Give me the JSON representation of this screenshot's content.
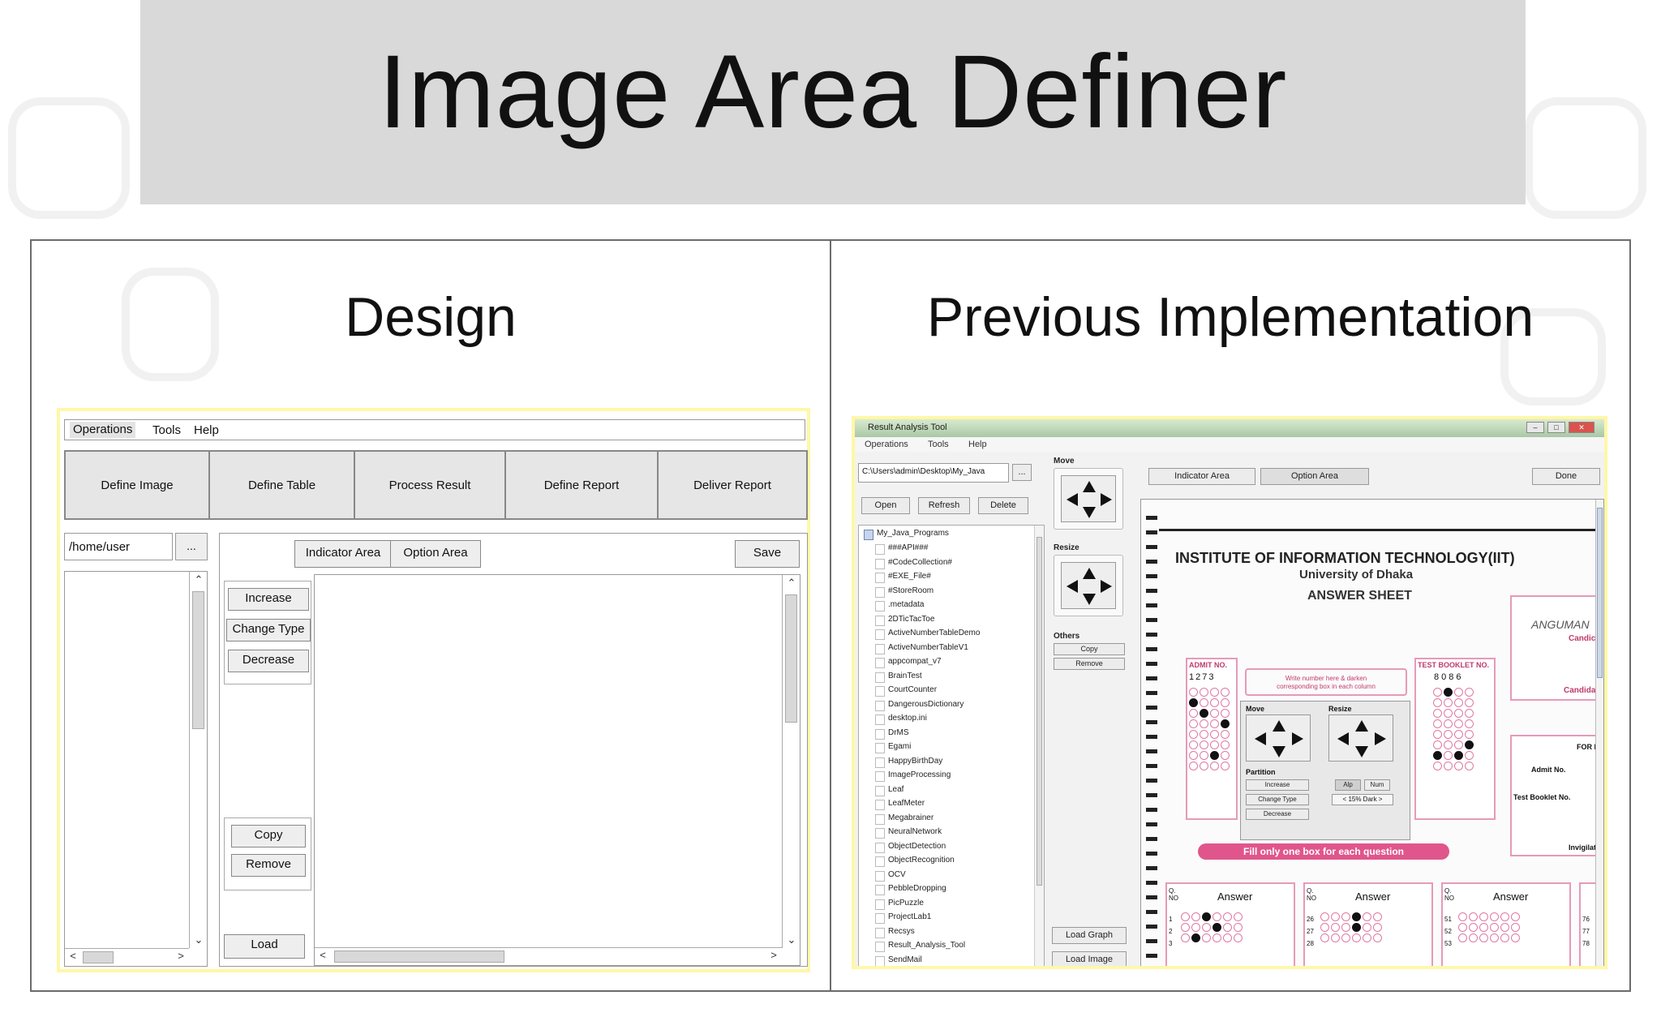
{
  "slide": {
    "title": "Image Area Definer",
    "left_heading": "Design",
    "right_heading": "Previous Implementation"
  },
  "design": {
    "menu": [
      "Operations",
      "Tools",
      "Help"
    ],
    "tabs": [
      "Define Image",
      "Define Table",
      "Process Result",
      "Define Report",
      "Deliver Report"
    ],
    "path_value": "/home/user",
    "browse_label": "...",
    "area_buttons": [
      "Indicator Area",
      "Option Area"
    ],
    "save_label": "Save",
    "partition_buttons": [
      "Increase",
      "Change Type",
      "Decrease"
    ],
    "other_buttons": [
      "Copy",
      "Remove"
    ],
    "load_label": "Load"
  },
  "previous": {
    "window_title": "Result Analysis Tool",
    "menu": [
      "Operations",
      "Tools",
      "Help"
    ],
    "path_value": "C:\\Users\\admin\\Desktop\\My_Java",
    "browse_label": "...",
    "file_buttons": [
      "Open",
      "Refresh",
      "Delete"
    ],
    "tree_root": "My_Java_Programs",
    "tree_items": [
      "###API###",
      "#CodeCollection#",
      "#EXE_File#",
      "#StoreRoom",
      ".metadata",
      "2DTicTacToe",
      "ActiveNumberTableDemo",
      "ActiveNumberTableV1",
      "appcompat_v7",
      "BrainTest",
      "CourtCounter",
      "DangerousDictionary",
      "desktop.ini",
      "DrMS",
      "Egami",
      "HappyBirthDay",
      "ImageProcessing",
      "Leaf",
      "LeafMeter",
      "Megabrainer",
      "NeuralNetwork",
      "ObjectDetection",
      "ObjectRecognition",
      "OCV",
      "PebbleDropping",
      "PicPuzzle",
      "ProjectLab1",
      "Recsys",
      "Result_Analysis_Tool",
      "SendMail"
    ],
    "tool_labels": {
      "move": "Move",
      "resize": "Resize",
      "others": "Others"
    },
    "other_buttons": [
      "Copy",
      "Remove"
    ],
    "load_buttons": [
      "Load Graph",
      "Load Image"
    ],
    "area_buttons": [
      "Indicator Area",
      "Option Area"
    ],
    "done_label": "Done",
    "sheet": {
      "institute": "INSTITUTE OF INFORMATION TECHNOLOGY(IIT)",
      "university": "University of Dhaka",
      "doc": "ANSWER SHEET",
      "admit_no": "ADMIT NO.",
      "booklet_no": "TEST BOOKLET NO.",
      "instruction": "Write number here & darken corresponding box in each column",
      "fill_note": "Fill only one box for each question",
      "answer_header": "Answer",
      "q_no": "Q. NO",
      "side_labels": [
        "Candic",
        "Candida",
        "FOR I",
        "Admit No.",
        "Test Booklet No.",
        "Invigilat"
      ],
      "signature": "ANGUMAN",
      "admit_digits": [
        "1",
        "2",
        "7",
        "3"
      ],
      "booklet_digits": [
        "8",
        "0",
        "8",
        "6"
      ],
      "row_numbers": [
        "1",
        "2",
        "3",
        "26",
        "27",
        "28",
        "51",
        "52",
        "53",
        "76",
        "77",
        "78"
      ]
    },
    "overlay": {
      "move": "Move",
      "resize": "Resize",
      "partition": "Partition",
      "buttons": [
        "Increase",
        "Change Type",
        "Decrease"
      ],
      "modes": [
        "Alp",
        "Num"
      ],
      "dark": "15% Dark"
    }
  }
}
